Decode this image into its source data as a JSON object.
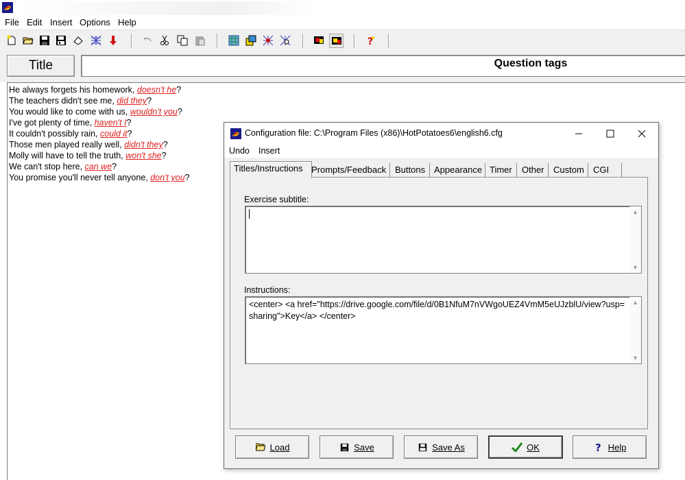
{
  "menu": [
    "File",
    "Edit",
    "Insert",
    "Options",
    "Help"
  ],
  "toolbar": {
    "icons": [
      "new-file-icon",
      "open-file-icon",
      "save-icon",
      "save-as-icon",
      "clear-icon",
      "mesh-icon",
      "arrow-down-icon",
      "undo-icon",
      "cut-icon",
      "copy-icon",
      "paste-icon",
      "web-page-icon",
      "export-icon",
      "hotpot-icon",
      "find-icon",
      "config-icon",
      "config-active-icon",
      "help-icon"
    ]
  },
  "title_button": "Title",
  "title_value": "Question tags",
  "sentences": [
    {
      "pre": "He always forgets his homework, ",
      "tag": "doesn't he",
      "post": "?"
    },
    {
      "pre": "The teachers didn't see me, ",
      "tag": "did they",
      "post": "?"
    },
    {
      "pre": "You would like to come with us, ",
      "tag": "wouldn't you",
      "post": "?"
    },
    {
      "pre": "I've got plenty of time, ",
      "tag": "haven't I",
      "post": "?"
    },
    {
      "pre": "It couldn't possibly rain, ",
      "tag": "could it",
      "post": "?"
    },
    {
      "pre": "Those men played really well, ",
      "tag": "didn't they",
      "post": "?"
    },
    {
      "pre": "Molly will have to tell the truth, ",
      "tag": "won't she",
      "post": "?"
    },
    {
      "pre": "We can't stop here, ",
      "tag": "can we",
      "post": "?"
    },
    {
      "pre": "You promise you'll never tell anyone, ",
      "tag": "don't you",
      "post": "?"
    }
  ],
  "dialog": {
    "title": "Configuration file: C:\\Program Files (x86)\\HotPotatoes6\\english6.cfg",
    "menu": [
      "Undo",
      "Insert"
    ],
    "tabs": [
      "Titles/Instructions",
      "Prompts/Feedback",
      "Buttons",
      "Appearance",
      "Timer",
      "Other",
      "Custom",
      "CGI"
    ],
    "active_tab": "Titles/Instructions",
    "subtitle_label": "Exercise subtitle:",
    "subtitle_value": "",
    "instructions_label": "Instructions:",
    "instructions_value": "<center> <a href=\"https://drive.google.com/file/d/0B1NfuM7nVWgoUEZ4VmM5eUJzblU/view?usp=sharing\">Key</a> </center>",
    "buttons": {
      "load": "Load",
      "save": "Save",
      "save_as": "Save As",
      "ok": "OK",
      "help": "Help"
    }
  },
  "colors": {
    "tag_text": "#e02020",
    "chrome": "#f0f0f0"
  }
}
